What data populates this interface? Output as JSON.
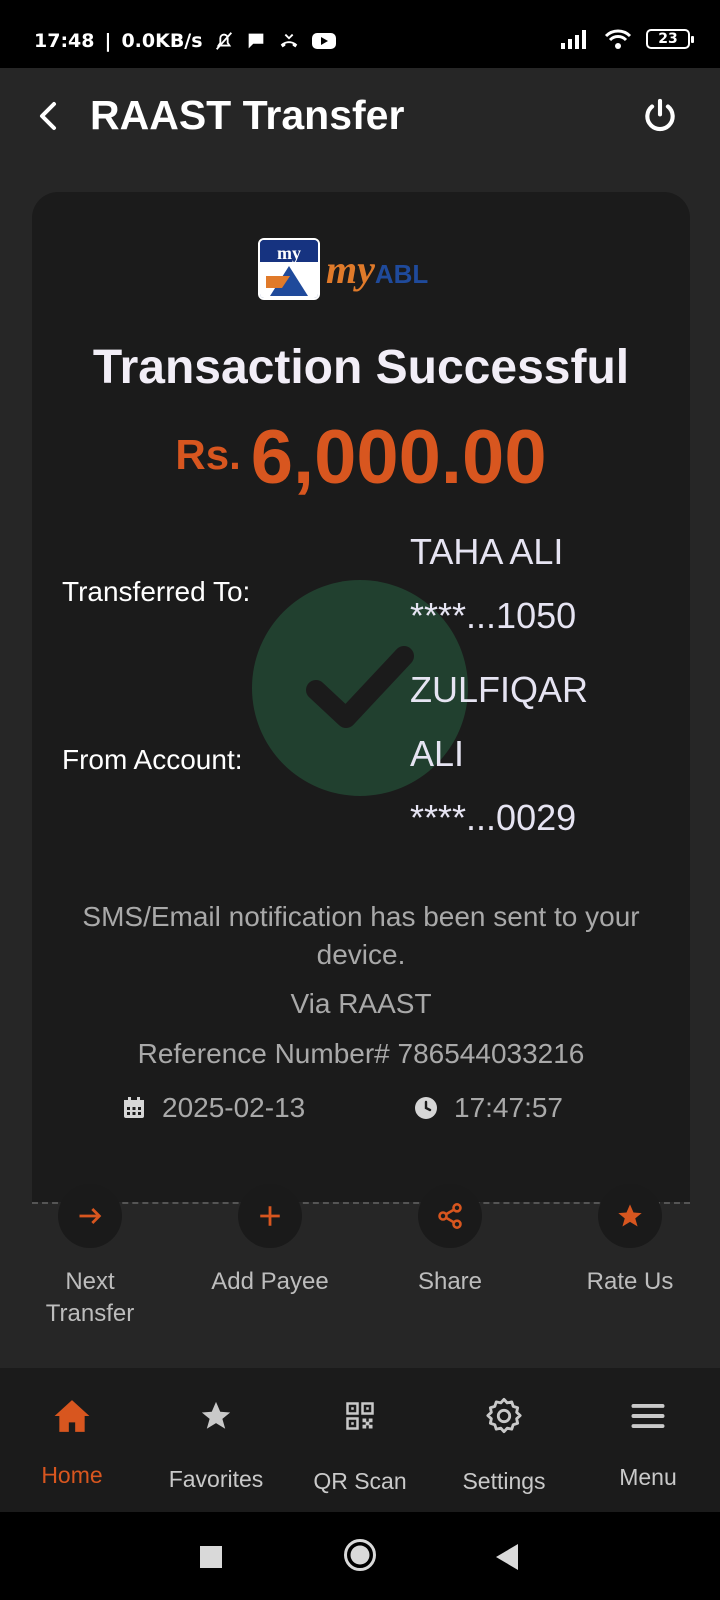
{
  "status_bar": {
    "time": "17:48",
    "speed": "0.0KB/s",
    "battery": "23"
  },
  "app_bar": {
    "title": "RAAST Transfer",
    "back_icon": "back-arrow-icon",
    "power_icon": "power-icon"
  },
  "receipt": {
    "logo_badge_text": "my",
    "logo_text": "my",
    "logo_text_suffix": "ABL",
    "heading": "Transaction Successful",
    "currency": "Rs.",
    "amount": "6,000.00",
    "transferred_to_label": "Transferred To:",
    "transferred_to_name": "TAHA ALI",
    "transferred_to_account": "****...1050",
    "from_account_label": "From Account:",
    "from_account_name_line1": "ZULFIQAR",
    "from_account_name_line2": "ALI",
    "from_account_number": "****...0029",
    "notice": "SMS/Email notification has been sent to your device.",
    "via": "Via RAAST",
    "reference": "Reference Number# 786544033216",
    "date": "2025-02-13",
    "time": "17:47:57"
  },
  "actions": [
    {
      "label": "Next Transfer",
      "icon": "arrow-right-icon"
    },
    {
      "label": "Add Payee",
      "icon": "plus-icon"
    },
    {
      "label": "Share",
      "icon": "share-icon"
    },
    {
      "label": "Rate Us",
      "icon": "star-icon"
    }
  ],
  "bottom_nav": [
    {
      "label": "Home",
      "icon": "home-icon",
      "active": true
    },
    {
      "label": "Favorites",
      "icon": "star-icon"
    },
    {
      "label": "QR Scan",
      "icon": "qr-icon"
    },
    {
      "label": "Settings",
      "icon": "gear-icon"
    },
    {
      "label": "Menu",
      "icon": "hamburger-icon"
    }
  ],
  "colors": {
    "accent": "#d8561f",
    "background": "#262626",
    "card": "#1b1b1b",
    "success_circle": "#21402f"
  }
}
